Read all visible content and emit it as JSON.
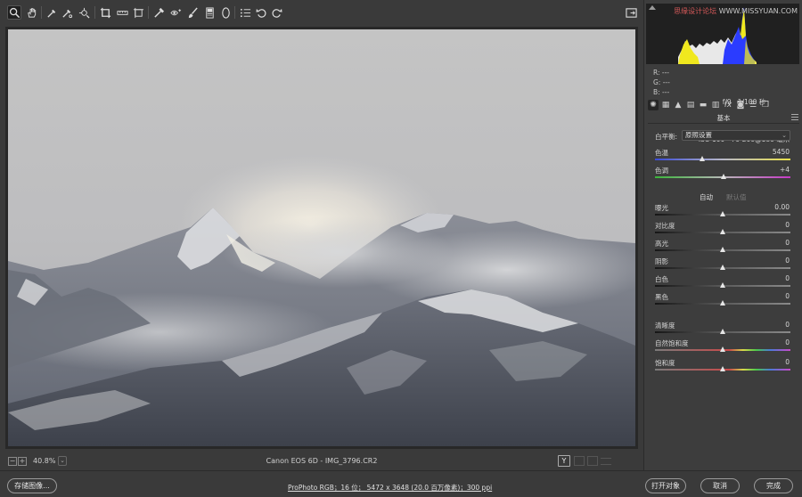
{
  "toolbar": {
    "tools": [
      "zoom-tool",
      "hand-tool",
      "white-balance-tool",
      "color-sampler-tool",
      "targeted-adjustment-tool",
      "crop-tool",
      "straighten-tool",
      "transform-tool",
      "spot-removal-tool",
      "red-eye-tool",
      "adjustment-brush-tool",
      "graduated-filter-tool",
      "radial-filter-tool",
      "open-preferences",
      "rotate-ccw",
      "rotate-cw"
    ]
  },
  "canvas": {
    "zoom": "40.8%",
    "zoom_minus": "−",
    "zoom_plus": "+",
    "zoom_menu": "⌄",
    "file_name": "Canon EOS 6D -  IMG_3796.CR2",
    "compare_label": "Y"
  },
  "histogram": {
    "watermark_cn": "思缘设计论坛",
    "watermark_url": "WWW.MISSYUAN.COM"
  },
  "readout": {
    "r": "R:   ---",
    "g": "G:   ---",
    "b": "B:   ---",
    "aperture": "f/9",
    "shutter": "1/100 秒",
    "iso": "ISO 100",
    "lens": "70-200@180 毫米"
  },
  "panel": {
    "title": "基本",
    "tabs": [
      "basic-tab",
      "tone-curve-tab",
      "detail-tab",
      "hsl-tab",
      "split-toning-tab",
      "lens-tab",
      "effects-tab",
      "camera-calibration-tab",
      "presets-tab",
      "snapshots-tab"
    ],
    "tab_glyphs": [
      "✺",
      "▦",
      "▲",
      "▤",
      "▬",
      "▥",
      "fx",
      "◙",
      "☰",
      "❐"
    ],
    "white_balance_label": "白平衡:",
    "white_balance_value": "原照设置",
    "auto": "自动",
    "default": "默认值",
    "sliders": [
      {
        "label": "色温",
        "value": "5450",
        "pos": 0.35,
        "gradient": "temp"
      },
      {
        "label": "色调",
        "value": "+4",
        "pos": 0.51,
        "gradient": "tint"
      },
      {
        "label": "曝光",
        "value": "0.00",
        "pos": 0.5,
        "gradient": "dark"
      },
      {
        "label": "对比度",
        "value": "0",
        "pos": 0.5,
        "gradient": "dark"
      },
      {
        "label": "高光",
        "value": "0",
        "pos": 0.5,
        "gradient": "dark"
      },
      {
        "label": "阴影",
        "value": "0",
        "pos": 0.5,
        "gradient": "dark"
      },
      {
        "label": "白色",
        "value": "0",
        "pos": 0.5,
        "gradient": "dark"
      },
      {
        "label": "黑色",
        "value": "0",
        "pos": 0.5,
        "gradient": "dark"
      },
      {
        "label": "清晰度",
        "value": "0",
        "pos": 0.5,
        "gradient": "dark"
      },
      {
        "label": "自然饱和度",
        "value": "0",
        "pos": 0.5,
        "gradient": "sat"
      },
      {
        "label": "饱和度",
        "value": "0",
        "pos": 0.5,
        "gradient": "sat"
      }
    ]
  },
  "bottom": {
    "save_image": "存储图像...",
    "workflow": "ProPhoto RGB；16 位；  5472 x 3648 (20.0 百万像素)；300 ppi",
    "open_object": "打开对象",
    "cancel": "取消",
    "done": "完成"
  },
  "colors": {
    "panel_bg": "#3d3d3d",
    "histogram_blue": "#2b3cff",
    "histogram_yellow": "#f0e81e",
    "temp_gradient": [
      "#3a4bd8",
      "#e8e04a"
    ],
    "tint_gradient": [
      "#3ab53a",
      "#c73ac7"
    ]
  }
}
